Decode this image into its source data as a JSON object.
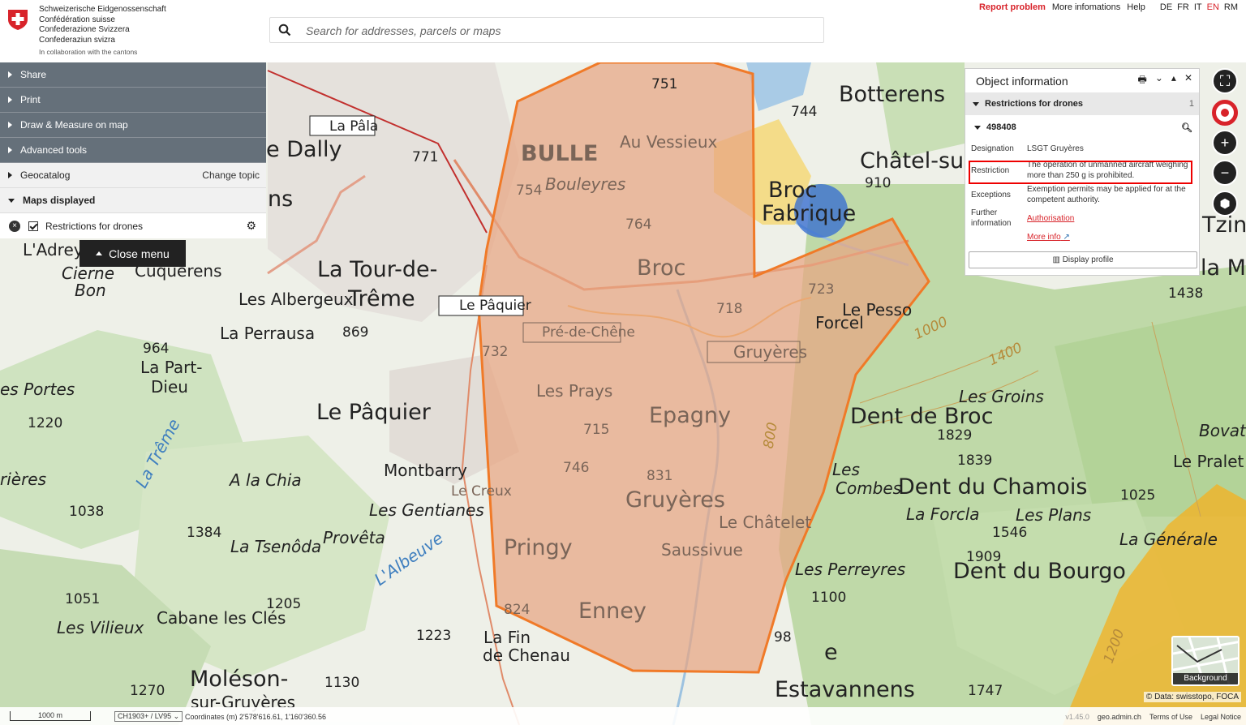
{
  "header": {
    "confed_lines": [
      "Schweizerische Eidgenossenschaft",
      "Confédération suisse",
      "Confederazione Svizzera",
      "Confederaziun svizra"
    ],
    "confed_sub": "In collaboration with the cantons",
    "search_placeholder": "Search for addresses, parcels or maps",
    "links": {
      "report": "Report problem",
      "more": "More infomations",
      "help": "Help"
    },
    "languages": [
      "DE",
      "FR",
      "IT",
      "EN",
      "RM"
    ],
    "active_language": "EN"
  },
  "menu": {
    "items": [
      "Share",
      "Print",
      "Draw & Measure on map",
      "Advanced tools"
    ],
    "geocatalog": "Geocatalog",
    "change_topic": "Change topic",
    "maps_displayed": "Maps displayed",
    "layer": "Restrictions for drones",
    "close": "Close menu"
  },
  "object_info": {
    "title": "Object information",
    "section": "Restrictions for drones",
    "section_count": "1",
    "feature_id": "498408",
    "rows": [
      {
        "key": "Designation",
        "value": "LSGT Gruyères"
      },
      {
        "key": "Restriction",
        "value": "The operation of unmanned aircraft weighing more than 250 g is prohibited."
      },
      {
        "key": "Exceptions",
        "value": "Exemption permits may be applied for at the competent authority."
      },
      {
        "key": "Further information",
        "value": "Authorisation"
      }
    ],
    "more_info": "More info",
    "display_profile": "Display profile"
  },
  "map": {
    "labels": {
      "bulle": "BULLE",
      "bouleyres": "Bouleyres",
      "au_vessieux": "Au Vessieux",
      "broc": "Broc",
      "la_tour": "La Tour-de-",
      "treme": "Trême",
      "le_paquier": "Le Pâquier",
      "epagny": "Epagny",
      "gruyeres": "Gruyères",
      "gruyeres_sign": "Gruyères",
      "les_prays": "Les Prays",
      "pringy": "Pringy",
      "enney": "Enney",
      "saussivue": "Saussivue",
      "le_chatelet": "Le Châtelet",
      "montbarry": "Montbarry",
      "le_creux": "Le Creux",
      "les_gentianes": "Les Gentianes",
      "proveta": "Provêta",
      "la_tsenoda": "La Tsenôda",
      "cabane": "Cabane les Clés",
      "moleson": "Moléson-",
      "moleson2": "sur-Gruyères",
      "les_vilieux": "Les Vilieux",
      "la_fin": "La Fin",
      "de_chenau": "de Chenau",
      "la_pala": "La Pâla",
      "le_dally": "e Dally",
      "botterens": "Botterens",
      "chatel": "Châtel-sur-M",
      "broc_fabrique": "Broc",
      "fabrique": "Fabrique",
      "forcel": "Forcel",
      "le_pessot": "Le Pesso",
      "les_groins": "Les Groins",
      "dent_broc": "Dent de Broc",
      "dent_chamois": "Dent du Chamois",
      "la_forcla": "La Forcla",
      "les_plans": "Les Plans",
      "la_generale": "La Générale",
      "dent_bourgo": "Dent du Bourgo",
      "les_perreyres": "Les Perreyres",
      "estavannens": "Estavannens",
      "le_pralet": "Le Pralet",
      "les_albergeux": "Les Albergeux",
      "la_perrausa": "La Perrausa",
      "la_part_dieu": "La Part-",
      "dieu": "Dieu",
      "les_portes": "es Portes",
      "cuquerens": "Cuquerens",
      "cierne": "Cierne",
      "bon": "Bon",
      "ladrey": "L'Adrey",
      "la_chia": "A la Chia",
      "la_treme_river": "La Trême",
      "albeuve": "L'Albeuve",
      "pre_de_chene": "Pré-de-Chêne",
      "le_paquier_sign": "Le Pâquier",
      "tzintr": "Tzintr",
      "lam": "la M",
      "bovat": "Bovat",
      "les_combes": "Les",
      "combes": "Combes",
      "ns": "ns",
      "rieres": "rières",
      "e": "e"
    },
    "elevations": [
      "751",
      "744",
      "910",
      "771",
      "754",
      "764",
      "723",
      "718",
      "732",
      "869",
      "964",
      "1220",
      "715",
      "746",
      "831",
      "1038",
      "1384",
      "1051",
      "1205",
      "1223",
      "1270",
      "1130",
      "824",
      "98",
      "1100",
      "1909",
      "1546",
      "1025",
      "1829",
      "1839",
      "1438",
      "1747",
      "1000",
      "1400",
      "800",
      "1200"
    ]
  },
  "controls": {
    "background": "Background"
  },
  "attribution": "© Data: swisstopo, FOCA",
  "footer": {
    "scale": "1000 m",
    "projection": "CH1903+ / LV95",
    "coordinates": "Coordinates (m) 2'578'616.61, 1'160'360.56",
    "version": "v1.45.0",
    "site": "geo.admin.ch",
    "terms": "Terms of Use",
    "legal": "Legal Notice"
  },
  "colors": {
    "accent": "#d8232a",
    "restriction_fill": "#e8a582",
    "restriction_stroke": "#f07a28",
    "menu_dark": "#65707a"
  }
}
